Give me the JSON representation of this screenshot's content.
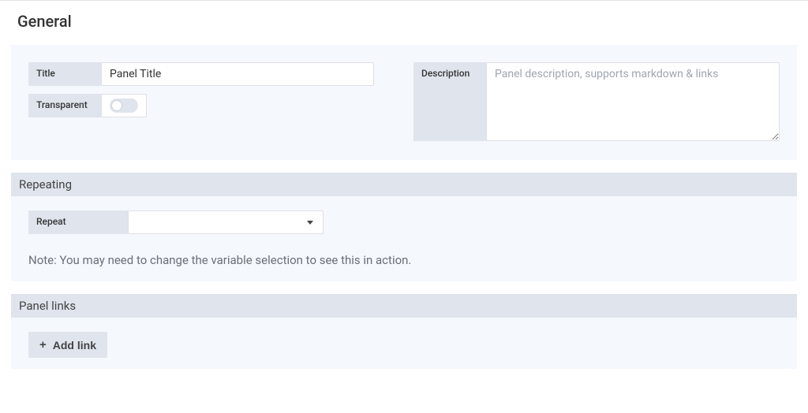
{
  "general": {
    "heading": "General",
    "title_label": "Title",
    "title_value": "Panel Title",
    "transparent_label": "Transparent",
    "transparent_on": false,
    "description_label": "Description",
    "description_placeholder": "Panel description, supports markdown & links",
    "description_value": ""
  },
  "repeating": {
    "heading": "Repeating",
    "repeat_label": "Repeat",
    "repeat_value": "",
    "note": "Note: You may need to change the variable selection to see this in action."
  },
  "panel_links": {
    "heading": "Panel links",
    "add_link_label": "Add link"
  }
}
